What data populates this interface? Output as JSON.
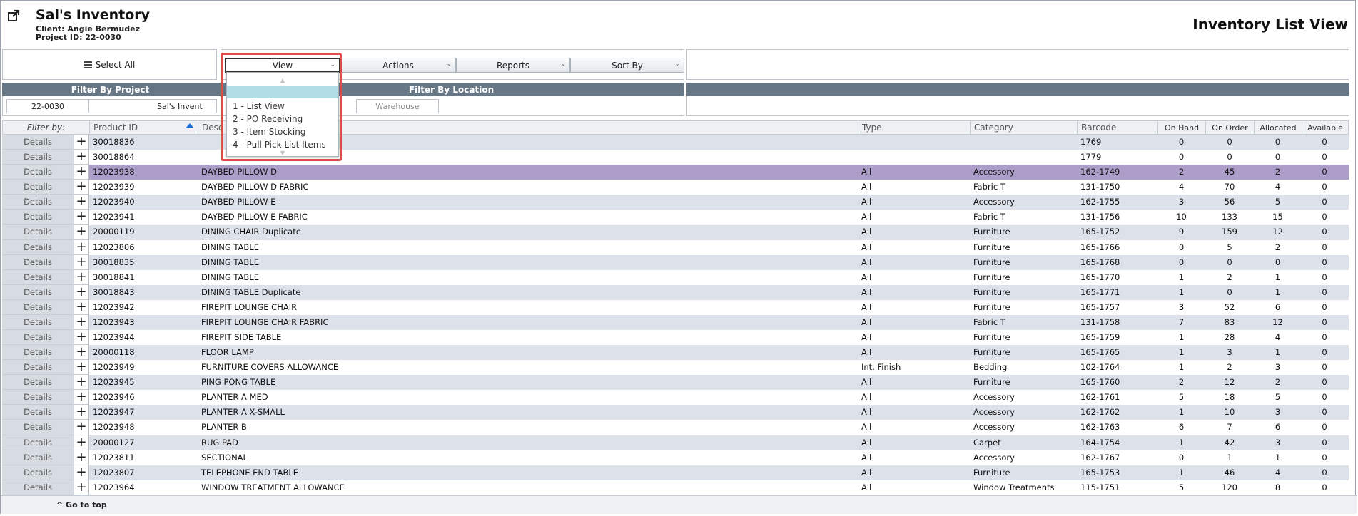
{
  "header": {
    "title": "Sal's Inventory",
    "client": "Client: Angie Bermudez",
    "project": "Project ID: 22-0030",
    "view_title": "Inventory List View"
  },
  "toolbar": {
    "select_all": "Select All",
    "menus": [
      "View",
      "Actions",
      "Reports",
      "Sort By"
    ]
  },
  "filters": {
    "project_header": "Filter By Project",
    "location_header": "Filter By Location",
    "project_id": "22-0030",
    "project_name": "Sal's Invent",
    "location_placeholder": "Warehouse"
  },
  "view_dropdown": {
    "items": [
      "",
      "1 - List View",
      "2 - PO Receiving",
      "3 - Item Stocking",
      "4 - Pull Pick List Items"
    ],
    "highlighted_index": 0
  },
  "grid": {
    "filter_label": "Filter by:",
    "details_label": "Details",
    "columns": [
      "Product ID",
      "Desc",
      "Type",
      "Category",
      "Barcode",
      "On Hand",
      "On Order",
      "Allocated",
      "Available"
    ],
    "sorted_column": "Product ID",
    "selected_row_index": 2,
    "rows": [
      [
        "30018836",
        "",
        "",
        "",
        "1769",
        "0",
        "0",
        "0",
        "0"
      ],
      [
        "30018864",
        "",
        "",
        "",
        "1779",
        "0",
        "0",
        "0",
        "0"
      ],
      [
        "12023938",
        "DAYBED PILLOW D",
        "All",
        "Accessory",
        "162-1749",
        "2",
        "45",
        "2",
        "0"
      ],
      [
        "12023939",
        "DAYBED PILLOW D FABRIC",
        "All",
        "Fabric T",
        "131-1750",
        "4",
        "70",
        "4",
        "0"
      ],
      [
        "12023940",
        "DAYBED PILLOW E",
        "All",
        "Accessory",
        "162-1755",
        "3",
        "56",
        "5",
        "0"
      ],
      [
        "12023941",
        "DAYBED PILLOW E FABRIC",
        "All",
        "Fabric T",
        "131-1756",
        "10",
        "133",
        "15",
        "0"
      ],
      [
        "20000119",
        "DINING CHAIR Duplicate",
        "All",
        "Furniture",
        "165-1752",
        "9",
        "159",
        "12",
        "0"
      ],
      [
        "12023806",
        "DINING TABLE",
        "All",
        "Furniture",
        "165-1766",
        "0",
        "5",
        "2",
        "0"
      ],
      [
        "30018835",
        "DINING TABLE",
        "All",
        "Furniture",
        "165-1768",
        "0",
        "0",
        "0",
        "0"
      ],
      [
        "30018841",
        "DINING TABLE",
        "All",
        "Furniture",
        "165-1770",
        "1",
        "2",
        "1",
        "0"
      ],
      [
        "30018843",
        "DINING TABLE Duplicate",
        "All",
        "Furniture",
        "165-1771",
        "1",
        "0",
        "1",
        "0"
      ],
      [
        "12023942",
        "FIREPIT LOUNGE CHAIR",
        "All",
        "Furniture",
        "165-1757",
        "3",
        "52",
        "6",
        "0"
      ],
      [
        "12023943",
        "FIREPIT LOUNGE CHAIR FABRIC",
        "All",
        "Fabric T",
        "131-1758",
        "7",
        "83",
        "12",
        "0"
      ],
      [
        "12023944",
        "FIREPIT SIDE TABLE",
        "All",
        "Furniture",
        "165-1759",
        "1",
        "28",
        "4",
        "0"
      ],
      [
        "20000118",
        "FLOOR LAMP",
        "All",
        "Furniture",
        "165-1765",
        "1",
        "3",
        "1",
        "0"
      ],
      [
        "12023949",
        "FURNITURE COVERS ALLOWANCE",
        "Int. Finish",
        "Bedding",
        "102-1764",
        "1",
        "2",
        "3",
        "0"
      ],
      [
        "12023945",
        "PING PONG TABLE",
        "All",
        "Furniture",
        "165-1760",
        "2",
        "12",
        "2",
        "0"
      ],
      [
        "12023946",
        "PLANTER A MED",
        "All",
        "Accessory",
        "162-1761",
        "5",
        "18",
        "5",
        "0"
      ],
      [
        "12023947",
        "PLANTER A X-SMALL",
        "All",
        "Accessory",
        "162-1762",
        "1",
        "10",
        "3",
        "0"
      ],
      [
        "12023948",
        "PLANTER B",
        "All",
        "Accessory",
        "162-1763",
        "6",
        "7",
        "6",
        "0"
      ],
      [
        "20000127",
        "RUG PAD",
        "All",
        "Carpet",
        "164-1754",
        "1",
        "42",
        "3",
        "0"
      ],
      [
        "12023811",
        "SECTIONAL",
        "All",
        "Accessory",
        "162-1767",
        "0",
        "1",
        "1",
        "0"
      ],
      [
        "12023807",
        "TELEPHONE END TABLE",
        "All",
        "Furniture",
        "165-1753",
        "1",
        "46",
        "4",
        "0"
      ],
      [
        "12023964",
        "WINDOW TREATMENT ALLOWANCE",
        "All",
        "Window Treatments",
        "115-1751",
        "5",
        "120",
        "8",
        "0"
      ]
    ]
  },
  "footer": {
    "go_top": "^ Go to top"
  },
  "colors": {
    "filter_header": "#677786",
    "row_alt": "#dde2ea",
    "row_selected": "#ad9ec9",
    "dropdown_highlight": "#b2dce6",
    "callout_outline": "#de4b4b",
    "sort_arrow": "#1b6ad8"
  }
}
